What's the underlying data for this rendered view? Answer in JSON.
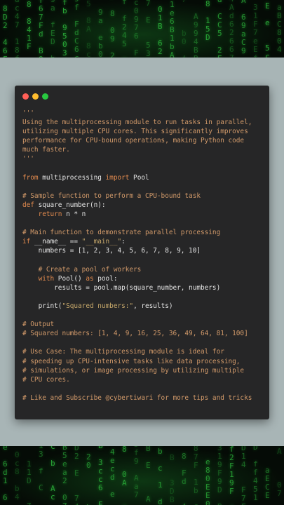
{
  "window": {
    "controls": [
      {
        "name": "close",
        "color": "#ff5f57"
      },
      {
        "name": "minimize",
        "color": "#ffbd2e"
      },
      {
        "name": "maximize",
        "color": "#28c840"
      }
    ]
  },
  "colors": {
    "comment": "#d29a6a",
    "keyword": "#e58c4f",
    "string": "#c8a96b",
    "function": "#f0c674",
    "plain": "#e6e6e6",
    "dunder": "#d4b16a"
  },
  "code_lines": [
    [
      {
        "t": "'''",
        "c": "comment"
      }
    ],
    [
      {
        "t": "Using the multiprocessing module to run tasks in parallel,",
        "c": "comment"
      }
    ],
    [
      {
        "t": "utilizing multiple CPU cores. This significantly improves",
        "c": "comment"
      }
    ],
    [
      {
        "t": "performance for CPU-bound operations, making Python code",
        "c": "comment"
      }
    ],
    [
      {
        "t": "much faster.",
        "c": "comment"
      }
    ],
    [
      {
        "t": "'''",
        "c": "comment"
      }
    ],
    [],
    [
      {
        "t": "from",
        "c": "keyword"
      },
      {
        "t": " multiprocessing ",
        "c": "plain"
      },
      {
        "t": "import",
        "c": "keyword"
      },
      {
        "t": " Pool",
        "c": "plain"
      }
    ],
    [],
    [
      {
        "t": "# Sample function to perform a CPU-bound task",
        "c": "comment"
      }
    ],
    [
      {
        "t": "def",
        "c": "keyword"
      },
      {
        "t": " square_number(n):",
        "c": "plain"
      }
    ],
    [
      {
        "t": "    ",
        "c": "plain"
      },
      {
        "t": "return",
        "c": "keyword"
      },
      {
        "t": " n * n",
        "c": "plain"
      }
    ],
    [],
    [
      {
        "t": "# Main function to demonstrate parallel processing",
        "c": "comment"
      }
    ],
    [
      {
        "t": "if",
        "c": "keyword"
      },
      {
        "t": " __name__ == ",
        "c": "plain"
      },
      {
        "t": "\"__main__\"",
        "c": "string"
      },
      {
        "t": ":",
        "c": "plain"
      }
    ],
    [
      {
        "t": "    numbers = [1, 2, 3, 4, 5, 6, 7, 8, 9, 10]",
        "c": "plain"
      }
    ],
    [],
    [
      {
        "t": "    # Create a pool of workers",
        "c": "comment"
      }
    ],
    [
      {
        "t": "    ",
        "c": "plain"
      },
      {
        "t": "with",
        "c": "keyword"
      },
      {
        "t": " Pool() ",
        "c": "plain"
      },
      {
        "t": "as",
        "c": "keyword"
      },
      {
        "t": " pool:",
        "c": "plain"
      }
    ],
    [
      {
        "t": "        results = pool.map(square_number, numbers)",
        "c": "plain"
      }
    ],
    [],
    [
      {
        "t": "    print(",
        "c": "plain"
      },
      {
        "t": "\"Squared numbers:\"",
        "c": "string"
      },
      {
        "t": ", results)",
        "c": "plain"
      }
    ],
    [],
    [
      {
        "t": "# Output",
        "c": "comment"
      }
    ],
    [
      {
        "t": "# Squared numbers: [1, 4, 9, 16, 25, 36, 49, 64, 81, 100]",
        "c": "comment"
      }
    ],
    [],
    [
      {
        "t": "# Use Case: The multiprocessing module is ideal for",
        "c": "comment"
      }
    ],
    [
      {
        "t": "# speeding up CPU-intensive tasks like data processing,",
        "c": "comment"
      }
    ],
    [
      {
        "t": "# simulations, or image processing by utilizing multiple",
        "c": "comment"
      }
    ],
    [
      {
        "t": "# CPU cores.",
        "c": "comment"
      }
    ],
    [],
    [
      {
        "t": "# Like and Subscribe @cybertiwari for more tips and tricks",
        "c": "comment"
      }
    ]
  ]
}
